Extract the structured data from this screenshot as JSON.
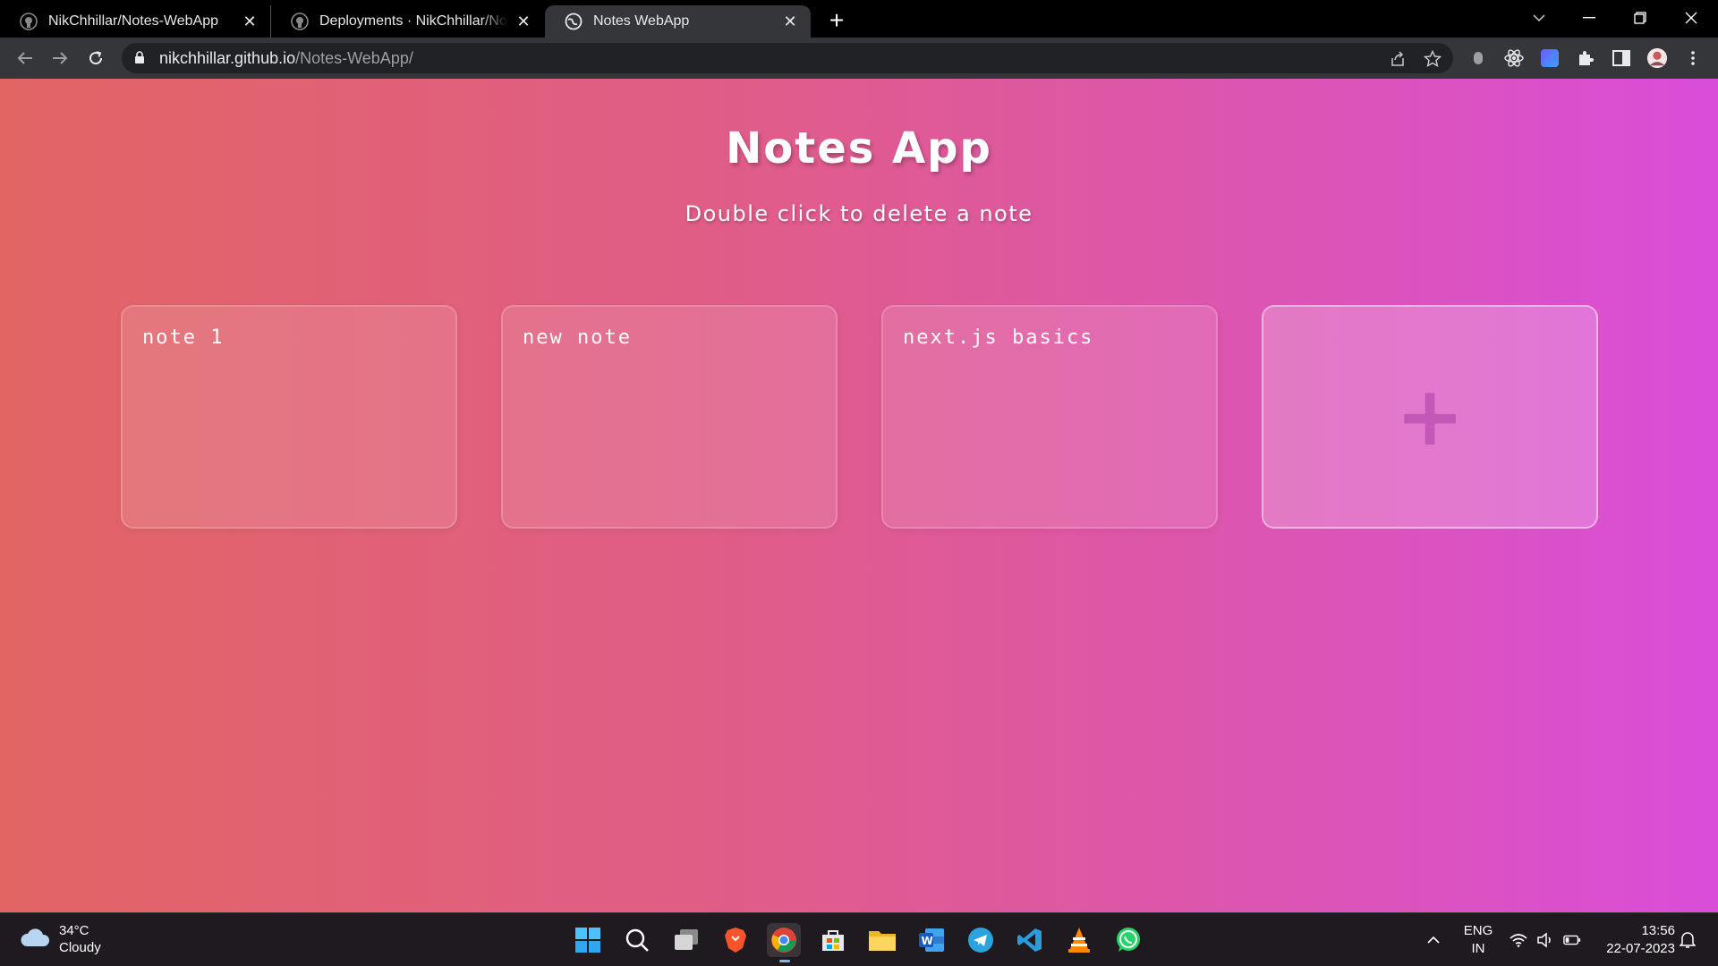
{
  "browser": {
    "tabs": [
      {
        "title": "NikChhillar/Notes-WebApp",
        "active": false
      },
      {
        "title": "Deployments · NikChhillar/Notes-WebApp",
        "active": false
      },
      {
        "title": "Notes WebApp",
        "active": true
      }
    ],
    "url_host": "nikchhillar.github.io",
    "url_path": "/Notes-WebApp/"
  },
  "app": {
    "title": "Notes App",
    "subtitle": "Double click to delete a note",
    "notes": [
      {
        "text": "note 1"
      },
      {
        "text": "new note"
      },
      {
        "text": "next.js basics"
      }
    ],
    "add_button_symbol": "+"
  },
  "taskbar": {
    "weather_temp": "34°C",
    "weather_desc": "Cloudy",
    "lang_primary": "ENG",
    "lang_secondary": "IN",
    "time": "13:56",
    "date": "22-07-2023"
  },
  "colors": {
    "gradient_start": "#e26564",
    "gradient_mid": "#e05c8a",
    "gradient_end": "#d94ed8"
  }
}
